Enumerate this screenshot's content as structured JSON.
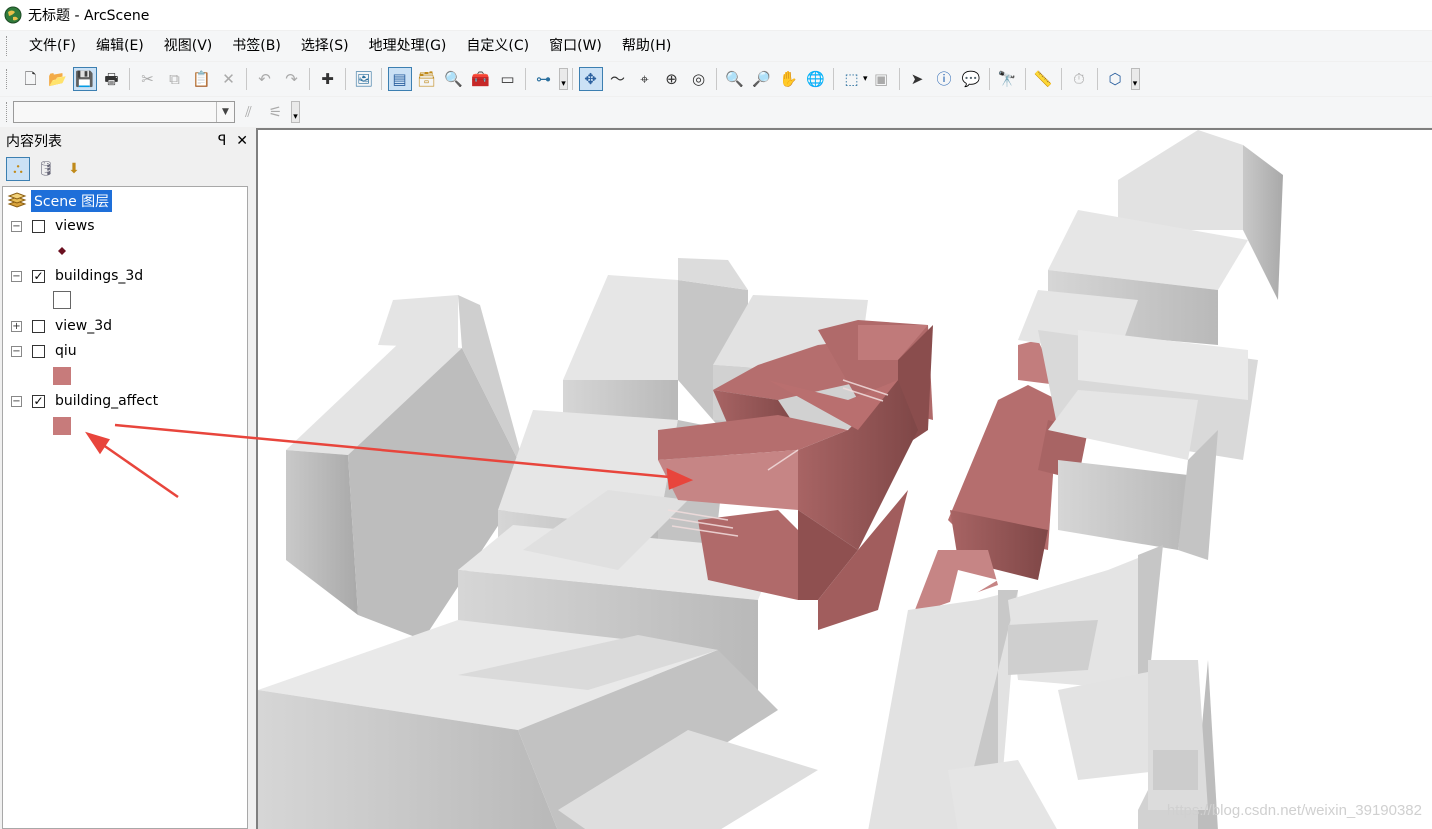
{
  "window": {
    "title": "无标题 - ArcScene"
  },
  "menu": [
    {
      "label": "文件(F)"
    },
    {
      "label": "编辑(E)"
    },
    {
      "label": "视图(V)"
    },
    {
      "label": "书签(B)"
    },
    {
      "label": "选择(S)"
    },
    {
      "label": "地理处理(G)"
    },
    {
      "label": "自定义(C)"
    },
    {
      "label": "窗口(W)"
    },
    {
      "label": "帮助(H)"
    }
  ],
  "toolbar": {
    "buttons": [
      "new-document-icon",
      "open-folder-icon",
      "save-icon",
      "print-icon",
      "cut-icon",
      "copy-icon",
      "paste-icon",
      "delete-icon",
      "undo-icon",
      "redo-icon",
      "add-data-icon",
      "scene-properties-icon",
      "toc-window-icon",
      "catalog-window-icon",
      "search-window-icon",
      "arctoolbox-icon",
      "python-icon",
      "model-builder-icon",
      "navigate-icon",
      "fly-icon",
      "center-target-icon",
      "zoom-target-icon",
      "set-observer-icon",
      "zoom-in-icon",
      "zoom-out-icon",
      "pan-hand-icon",
      "full-extent-icon",
      "select-features-icon",
      "clear-selection-icon",
      "select-elements-icon",
      "identify-icon",
      "html-popup-icon",
      "find-icon",
      "measure-icon",
      "time-slider-icon",
      "3d-effects-icon"
    ]
  },
  "toc": {
    "title": "内容列表",
    "pin_glyph": "ꟼ",
    "close_glyph": "✕",
    "scene_label": "Scene 图层",
    "layers": [
      {
        "name": "views",
        "checked": false,
        "expanded": true
      },
      {
        "name": "buildings_3d",
        "checked": true,
        "expanded": true
      },
      {
        "name": "view_3d",
        "checked": false,
        "expanded": false
      },
      {
        "name": "qiu",
        "checked": false,
        "expanded": true
      },
      {
        "name": "building_affect",
        "checked": true,
        "expanded": true
      }
    ],
    "symbol_colors": {
      "views": "#6b1020",
      "buildings_3d": "#ffffff",
      "qiu": "#c77b7b",
      "building_affect": "#c77b7b"
    }
  },
  "scene": {
    "building_color": "#e2e2e2",
    "affected_color": "#b56e6e",
    "watermark": "https://blog.csdn.net/weixin_39190382"
  },
  "annotation": {
    "arrow_color": "#e8453c"
  }
}
